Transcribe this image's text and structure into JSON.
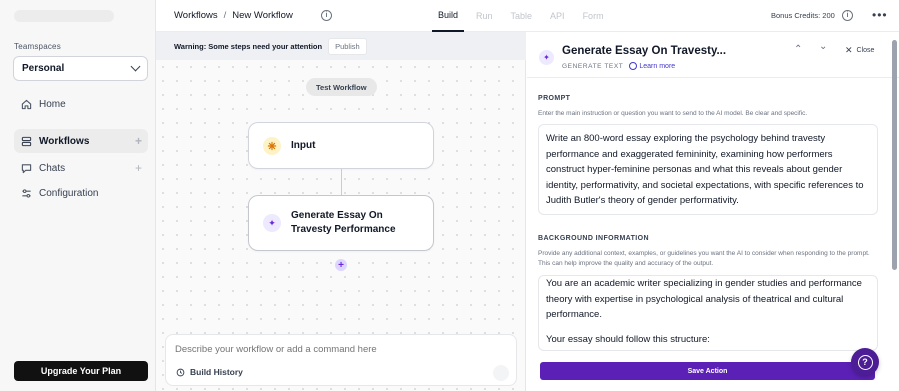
{
  "sidebar": {
    "teamspaces_label": "Teamspaces",
    "team_selected": "Personal",
    "items": [
      {
        "label": "Home",
        "icon": "home-icon"
      },
      {
        "label": "Workflows",
        "icon": "workflow-icon",
        "active": true
      },
      {
        "label": "Chats",
        "icon": "chat-icon"
      },
      {
        "label": "Configuration",
        "icon": "sliders-icon"
      }
    ],
    "upgrade_label": "Upgrade Your Plan"
  },
  "topbar": {
    "breadcrumb_root": "Workflows",
    "breadcrumb_sep": "/",
    "breadcrumb_current": "New Workflow",
    "tabs": [
      "Build",
      "Run",
      "Table",
      "API",
      "Form"
    ],
    "active_tab": "Build",
    "credits": "Bonus Credits: 200"
  },
  "canvas": {
    "warning_text": "Warning: Some steps need your attention",
    "publish_label": "Publish",
    "test_label": "Test Workflow",
    "nodes": [
      {
        "title": "Input",
        "icon": "input-icon"
      },
      {
        "title": "Generate Essay On Travesty Performance",
        "icon": "sparkle-icon"
      }
    ],
    "command_placeholder": "Describe your workflow or add a command here",
    "build_history_label": "Build History"
  },
  "panel": {
    "title": "Generate Essay On Travesty...",
    "subtitle": "GENERATE TEXT",
    "learn_more": "Learn more",
    "close_label": "Close",
    "prompt_label": "PROMPT",
    "prompt_help": "Enter the main instruction or question you want to send to the AI model. Be clear and specific.",
    "prompt_value": "Write an 800-word essay exploring the psychology behind travesty performance and exaggerated femininity, examining how performers construct hyper-feminine personas and what this reveals about gender identity, performativity, and societal expectations, with specific references to Judith Butler's theory of gender performativity.",
    "background_label": "BACKGROUND INFORMATION",
    "background_help": "Provide any additional context, examples, or guidelines you want the AI to consider when responding to the prompt. This can help improve the quality and accuracy of the output.",
    "background_p1": "You are an academic writer specializing in gender studies and performance theory with expertise in psychological analysis of theatrical and cultural performance.",
    "background_p2": "Your essay should follow this structure:",
    "save_label": "Save Action"
  },
  "colors": {
    "accent": "#5b21b6",
    "fab": "#4c1d95",
    "upgrade_bg": "#111111"
  }
}
